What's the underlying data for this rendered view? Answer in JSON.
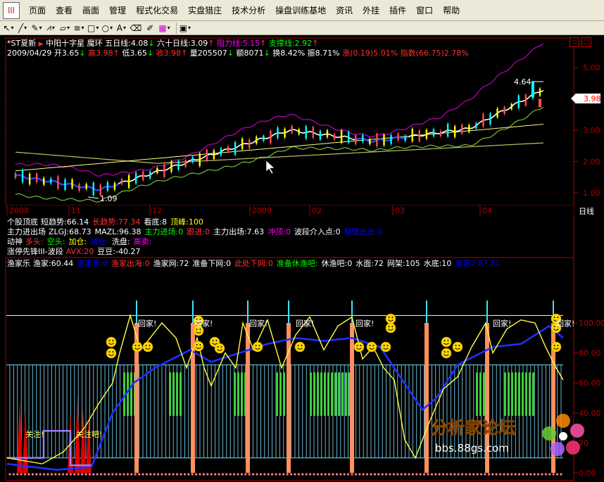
{
  "menu": {
    "items": [
      "页面",
      "查看",
      "画面",
      "管理",
      "程式化交易",
      "实盘猎庄",
      "技术分析",
      "操盘训练基地",
      "资讯",
      "外挂",
      "插件",
      "窗口",
      "帮助"
    ]
  },
  "toolbar": {
    "tools": [
      "cursor",
      "line",
      "pencil",
      "zigzag",
      "channel",
      "fibonacci",
      "rectangle",
      "ellipse",
      "text",
      "eraser",
      "brush",
      "color",
      "save"
    ],
    "font_letter": "A"
  },
  "stock": {
    "name": "*ST夏新",
    "sector": "中阳十字星",
    "pattern": "魔环",
    "ma5": "五日线:4.08",
    "ma60": "六十日线:3.09",
    "resistance": "阻力线:5.15",
    "support": "支撑线:2.92",
    "date": "2009/04/29",
    "open": "开3.65",
    "high": "高3.98",
    "low": "低3.65",
    "close": "收3.98",
    "volume": "量205507",
    "amount": "额8071",
    "turnover": "换8.42%",
    "amplitude": "振8.71%",
    "change": "涨(0.19)5.01%",
    "index": "指数(66.75)2.78%"
  },
  "price_chart": {
    "y_ticks": [
      "5.00",
      "4.00",
      "3.00",
      "2.00",
      "1.00"
    ],
    "high_label": "4.64",
    "low_label": "1.09",
    "current_price": "3.98",
    "x_labels": [
      "2008",
      "11",
      "12",
      "2009",
      "02",
      "03",
      "04"
    ],
    "period": "日线"
  },
  "indicators": [
    {
      "name": "个股顶底",
      "parts": [
        {
          "t": "短趋势:66.14",
          "c": "#ffffff"
        },
        {
          "t": "长趋势:77.34",
          "c": "#ff3030"
        },
        {
          "t": "看底:8",
          "c": "#ffffff"
        },
        {
          "t": "顶峰:100",
          "c": "#ffff00"
        }
      ]
    },
    {
      "name": "主力进出场",
      "parts": [
        {
          "t": "ZLGJ:68.73",
          "c": "#ffffff"
        },
        {
          "t": "MAZL:96.38",
          "c": "#ffffff"
        },
        {
          "t": "主力进场:0",
          "c": "#00ff00"
        },
        {
          "t": "跟进:0",
          "c": "#ff3030"
        },
        {
          "t": "主力出场:7.63",
          "c": "#ffffff"
        },
        {
          "t": "冲顶:0",
          "c": "#ff00ff"
        },
        {
          "t": "波段介入点:0",
          "c": "#ffffff"
        },
        {
          "t": "稳健出击:0",
          "c": "#0000ff"
        }
      ]
    },
    {
      "name": "动神",
      "parts": [
        {
          "t": "多头:",
          "c": "#ff3030"
        },
        {
          "t": "空头:",
          "c": "#00ff00"
        },
        {
          "t": "加仓:",
          "c": "#ffff00"
        },
        {
          "t": "减仓:",
          "c": "#0000ff"
        },
        {
          "t": "洗盘:",
          "c": "#ffffff"
        },
        {
          "t": "高卖:",
          "c": "#ff00ff"
        }
      ]
    },
    {
      "name": "涨停先锋III-波段",
      "parts": [
        {
          "t": "AVX:20",
          "c": "#ff3030"
        },
        {
          "t": "豆豆:-40.27",
          "c": "#ffffff"
        }
      ]
    }
  ],
  "lower_panel": {
    "name": "渔家乐",
    "parts": [
      {
        "t": "渔家:60.44",
        "c": "#ffffff"
      },
      {
        "t": "渔家乐:0",
        "c": "#0000ff"
      },
      {
        "t": "渔家出海:0",
        "c": "#ff3030"
      },
      {
        "t": "渔家网:72",
        "c": "#ffffff"
      },
      {
        "t": "准备下网:0",
        "c": "#ffffff"
      },
      {
        "t": "此处下网:0",
        "c": "#ff3030"
      },
      {
        "t": "准备休渔吧:",
        "c": "#00ff00"
      },
      {
        "t": "休渔吧:0",
        "c": "#ffffff"
      },
      {
        "t": "水面:72",
        "c": "#ffffff"
      },
      {
        "t": "网架:105",
        "c": "#ffffff"
      },
      {
        "t": "水底:10",
        "c": "#ffffff"
      },
      {
        "t": "渔家2:87.81",
        "c": "#0000ff"
      }
    ],
    "y_ticks": [
      "100.00",
      "80.00",
      "60.00",
      "40.00",
      "20",
      "0.00"
    ],
    "go_home_label": "回家!",
    "attention_label": "关注!",
    "attention_label2": "关注吧!"
  },
  "watermark": {
    "title": "分析家论坛",
    "url": "bbs.88gs.com"
  }
}
